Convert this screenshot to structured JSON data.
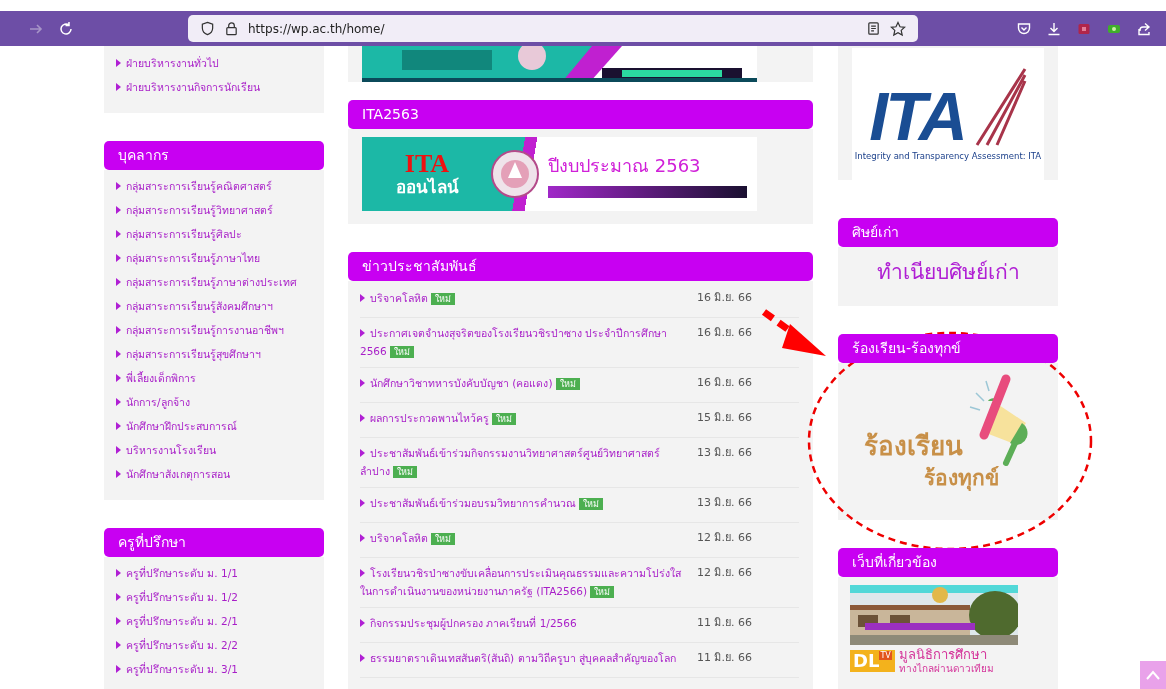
{
  "browser": {
    "url": "https://wp.ac.th/home/"
  },
  "left_column": {
    "top_links": [
      "ฝ่ายบริหารงานทั่วไป",
      "ฝ่ายบริหารงานกิจการนักเรียน"
    ],
    "widgets": [
      {
        "title": "บุคลากร",
        "links": [
          "กลุ่มสาระการเรียนรู้คณิตศาสตร์",
          "กลุ่มสาระการเรียนรู้วิทยาศาสตร์",
          "กลุ่มสาระการเรียนรู้ศิลปะ",
          "กลุ่มสาระการเรียนรู้ภาษาไทย",
          "กลุ่มสาระการเรียนรู้ภาษาต่างประเทศ",
          "กลุ่มสาระการเรียนรู้สังคมศึกษาฯ",
          "กลุ่มสาระการเรียนรู้การงานอาชีพฯ",
          "กลุ่มสาระการเรียนรู้สุขศึกษาฯ",
          "พี่เลี้ยงเด็กพิการ",
          "นักการ/ลูกจ้าง",
          "นักศึกษาฝึกประสบการณ์",
          "บริหารงานโรงเรียน",
          "นักศึกษาสังเกตุการสอน"
        ]
      },
      {
        "title": "ครูที่ปรึกษา",
        "links": [
          "ครูที่ปรึกษาระดับ ม. 1/1",
          "ครูที่ปรึกษาระดับ ม. 1/2",
          "ครูที่ปรึกษาระดับ ม. 2/1",
          "ครูที่ปรึกษาระดับ ม. 2/2",
          "ครูที่ปรึกษาระดับ ม. 3/1"
        ]
      }
    ]
  },
  "middle_column": {
    "widgets": [
      {
        "kind": "banner",
        "title": "ITA2563",
        "banner": {
          "title": "ITA",
          "subtitle": "ออนไลน์",
          "caption": "ปีงบประมาณ 2563"
        }
      },
      {
        "kind": "news",
        "title": "ข่าวประชาสัมพันธ์",
        "items": [
          {
            "title": "บริจาคโลหิต",
            "badge": "ใหม่",
            "date": "16 มิ.ย. 66"
          },
          {
            "title": "ประกาศเจตจำนงสุจริตของโรงเรียนวชิรป่าซาง ประจำปีการศึกษา 2566",
            "badge": "ใหม่",
            "date": "16 มิ.ย. 66"
          },
          {
            "title": "นักศึกษาวิชาทหารบังคับบัญชา (คอแดง)",
            "badge": "ใหม่",
            "date": "16 มิ.ย. 66"
          },
          {
            "title": "ผลการประกวดพานไหว้ครู",
            "badge": "ใหม่",
            "date": "15 มิ.ย. 66"
          },
          {
            "title": "ประชาสัมพันธ์เข้าร่วมกิจกรรมงานวิทยาศาสตร์ศูนย์วิทยาศาสตร์ลำปาง",
            "badge": "ใหม่",
            "date": "13 มิ.ย. 66"
          },
          {
            "title": "ประชาสัมพันธ์เข้าร่วมอบรมวิทยาการคำนวณ",
            "badge": "ใหม่",
            "date": "13 มิ.ย. 66"
          },
          {
            "title": "บริจาคโลหิต",
            "badge": "ใหม่",
            "date": "12 มิ.ย. 66"
          },
          {
            "title": "โรงเรียนวชิรป่าซางขับเคลื่อนการประเมินคุณธรรมและความโปร่งใสในการดำเนินงานของหน่วยงานภาครัฐ (ITA2566)",
            "badge": "ใหม่",
            "date": "12 มิ.ย. 66"
          },
          {
            "title": "กิจกรรมประชุมผู้ปกครอง ภาคเรียนที่ 1/2566",
            "date": "11 มิ.ย. 66"
          },
          {
            "title": "ธรรมยาตราเดินเทสสันตริ(สันถิ) ตามวิถีครูบา สู่บุคคลสำคัญของโลก",
            "date": "11 มิ.ย. 66"
          }
        ]
      }
    ]
  },
  "right_column": {
    "logo": {
      "letters": "ITA",
      "caption": "Integrity and Transparency  Assessment: ITA"
    },
    "widgets": [
      {
        "kind": "link",
        "title": "ศิษย์เก่า",
        "link": "ทำเนียบศิษย์เก่า"
      },
      {
        "kind": "promo",
        "title": "ร้องเรียน-ร้องทุกข์",
        "lines": [
          "ร้องเรียน",
          "ร้องทุกข์"
        ]
      },
      {
        "kind": "links",
        "title": "เว็บที่เกี่ยวข้อง",
        "banners": [
          {
            "kind": "picture"
          },
          {
            "kind": "dltv",
            "logo": "DL",
            "logo_sup": "TV",
            "lines": [
              "มูลนิธิการศึกษา",
              "ทางไกลผ่านดาวเทียม"
            ]
          }
        ]
      }
    ]
  }
}
